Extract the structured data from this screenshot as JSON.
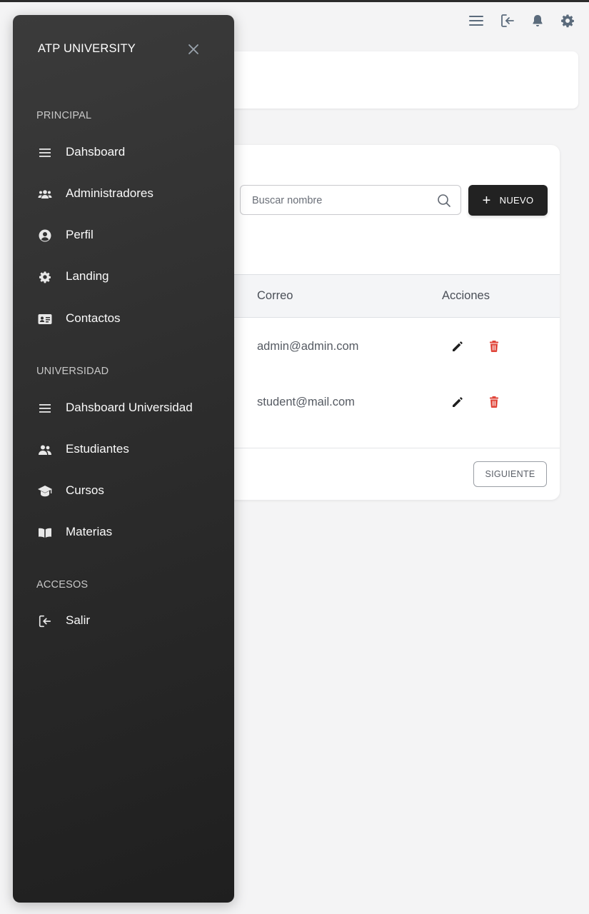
{
  "drawer": {
    "brand": "ATP UNIVERSITY",
    "close_icon": "close-icon",
    "sections": [
      {
        "title": "PRINCIPAL",
        "items": [
          {
            "label": "Dahsboard",
            "icon": "menu-icon"
          },
          {
            "label": "Administradores",
            "icon": "users-group-icon"
          },
          {
            "label": "Perfil",
            "icon": "user-circle-icon"
          },
          {
            "label": "Landing",
            "icon": "gear-icon"
          },
          {
            "label": "Contactos",
            "icon": "contact-card-icon"
          }
        ]
      },
      {
        "title": "UNIVERSIDAD",
        "items": [
          {
            "label": "Dahsboard Universidad",
            "icon": "menu-icon"
          },
          {
            "label": "Estudiantes",
            "icon": "users-icon"
          },
          {
            "label": "Cursos",
            "icon": "graduation-cap-icon"
          },
          {
            "label": "Materias",
            "icon": "book-icon"
          }
        ]
      },
      {
        "title": "ACCESOS",
        "items": [
          {
            "label": "Salir",
            "icon": "logout-icon"
          }
        ]
      }
    ]
  },
  "topbar": {
    "icons": [
      "menu-icon",
      "logout-icon",
      "bell-icon",
      "gear-icon"
    ]
  },
  "main": {
    "search": {
      "placeholder": "Buscar nombre",
      "value": ""
    },
    "new_button_label": "NUEVO",
    "table": {
      "headers": [
        "Correo",
        "Acciones"
      ],
      "rows": [
        {
          "email": "admin@admin.com"
        },
        {
          "email": "student@mail.com"
        }
      ]
    },
    "next_button_label": "SIGUIENTE"
  },
  "colors": {
    "drawer_bg": "#2c2c2c",
    "accent_dark": "#222222",
    "delete_red": "#e0453a",
    "page_bg": "#f4f4f5"
  }
}
